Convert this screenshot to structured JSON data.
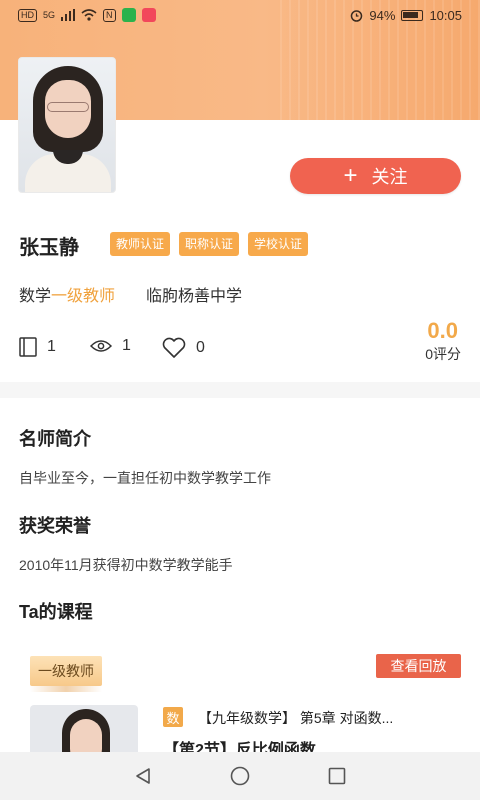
{
  "status_bar": {
    "left_badges": [
      "HD",
      "5G"
    ],
    "battery": "94%",
    "time": "10:05"
  },
  "colors": {
    "accent_orange": "#f7a94b",
    "follow_red": "#f06350",
    "rating_orange": "#f2a94a",
    "header_gradient": "#f9b987"
  },
  "profile": {
    "name": "张玉静",
    "badges": [
      "教师认证",
      "职称认证",
      "学校认证"
    ],
    "subject": "数学",
    "rank": "一级教师",
    "school": "临朐杨善中学",
    "follow_label": "关注",
    "follow_icon": "plus-icon",
    "stats": {
      "courses": "1",
      "views": "1",
      "likes": "0"
    },
    "rating_value": "0.0",
    "rating_label": "0评分"
  },
  "sections": {
    "intro_title": "名师简介",
    "intro_text": "自毕业至今，一直担任初中数学教学工作",
    "honor_title": "获奖荣誉",
    "honor_text": "2010年11月获得初中数学教学能手",
    "courses_title": "Ta的课程"
  },
  "course": {
    "tag": "一级教师",
    "replay_label": "查看回放",
    "subject_chip": "数",
    "line1": "【九年级数学】 第5章  对函数...",
    "line2": "【第2节】反比例函数"
  },
  "nav": {
    "icons": [
      "back-icon",
      "home-icon",
      "recents-icon"
    ]
  }
}
